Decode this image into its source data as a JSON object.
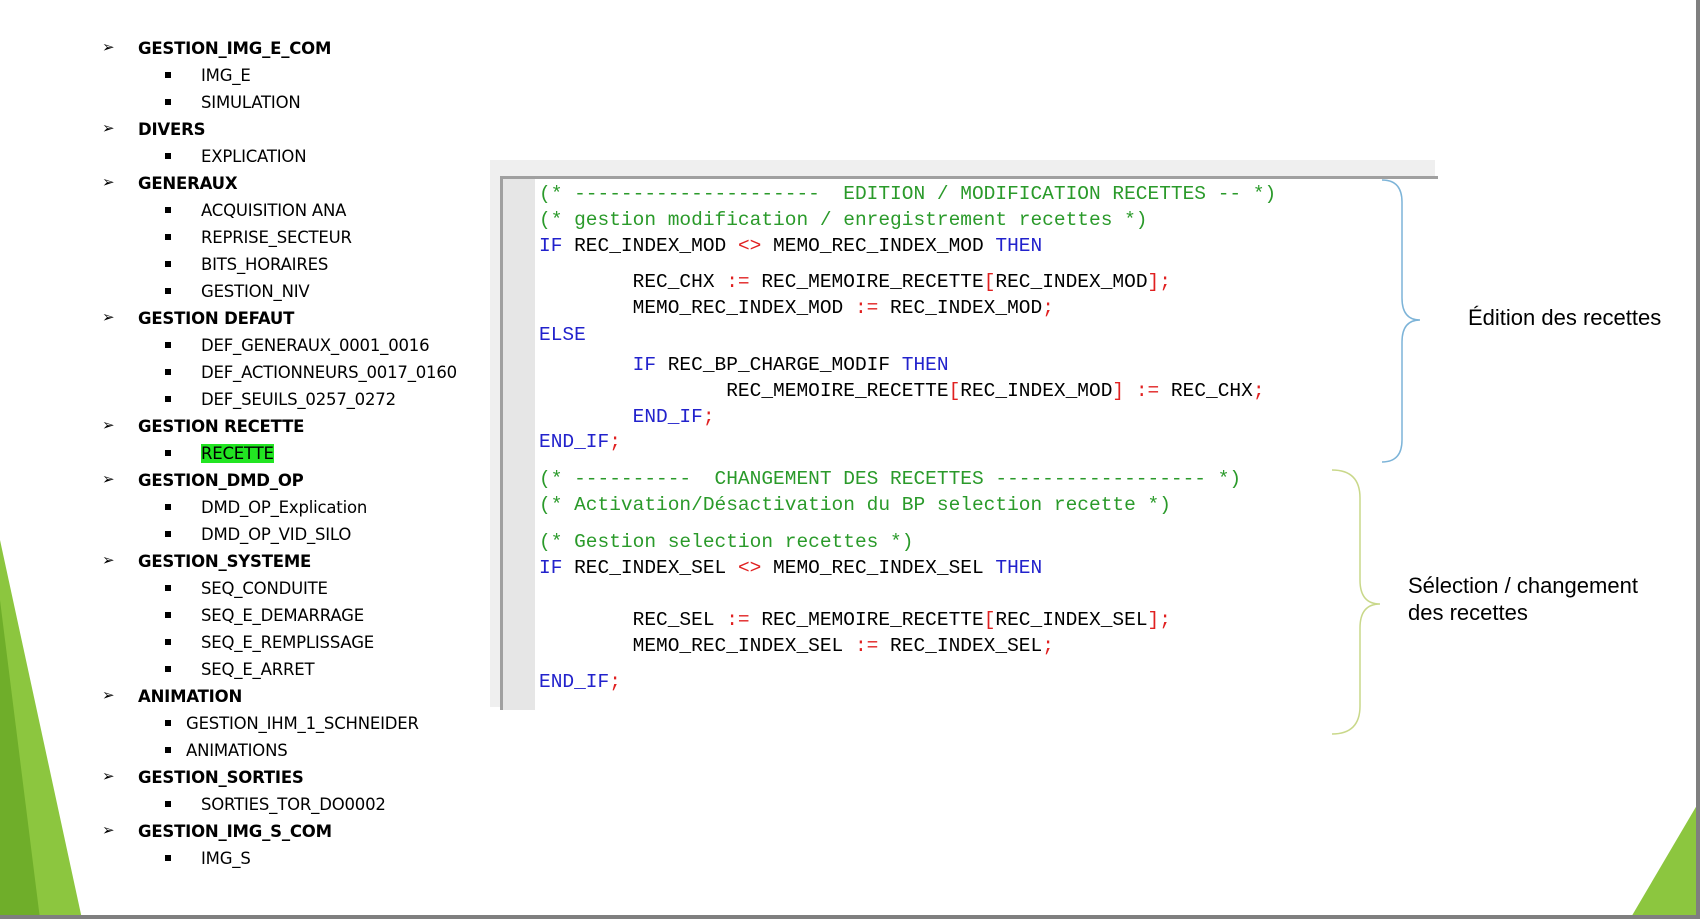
{
  "tree": {
    "groups": [
      {
        "label": "GESTION_IMG_E_COM",
        "items": [
          {
            "label": "IMG_E"
          },
          {
            "label": "SIMULATION"
          }
        ]
      },
      {
        "label": "DIVERS",
        "items": [
          {
            "label": "EXPLICATION"
          }
        ]
      },
      {
        "label": "GENERAUX",
        "items": [
          {
            "label": "ACQUISITION ANA"
          },
          {
            "label": "REPRISE_SECTEUR"
          },
          {
            "label": "BITS_HORAIRES"
          },
          {
            "label": "GESTION_NIV"
          }
        ]
      },
      {
        "label": "GESTION DEFAUT",
        "items": [
          {
            "label": "DEF_GENERAUX_0001_0016"
          },
          {
            "label": "DEF_ACTIONNEURS_0017_0160"
          },
          {
            "label": "DEF_SEUILS_0257_0272"
          }
        ]
      },
      {
        "label": "GESTION RECETTE",
        "items": [
          {
            "label": "RECETTE",
            "highlighted": true
          }
        ]
      },
      {
        "label": "GESTION_DMD_OP",
        "items": [
          {
            "label": "DMD_OP_Explication"
          },
          {
            "label": "DMD_OP_VID_SILO"
          }
        ]
      },
      {
        "label": "GESTION_SYSTEME",
        "items": [
          {
            "label": "SEQ_CONDUITE"
          },
          {
            "label": "SEQ_E_DEMARRAGE"
          },
          {
            "label": "SEQ_E_REMPLISSAGE"
          },
          {
            "label": "SEQ_E_ARRET"
          }
        ]
      },
      {
        "label": "ANIMATION",
        "items": [
          {
            "label": "GESTION_IHM_1_SCHNEIDER",
            "shallow": true
          },
          {
            "label": "ANIMATIONS",
            "shallow": true
          }
        ]
      },
      {
        "label": "GESTION_SORTIES",
        "items": [
          {
            "label": "SORTIES_TOR_DO0002"
          }
        ]
      },
      {
        "label": "GESTION_IMG_S_COM",
        "items": [
          {
            "label": "IMG_S"
          }
        ]
      }
    ],
    "highlight_color": "#22e522"
  },
  "code": {
    "colors": {
      "comment": "#2a9a2a",
      "keyword": "#2222cc",
      "operator": "#e02020",
      "text": "#000000"
    },
    "lines": [
      [
        [
          "cm",
          "(* ---------------------  EDITION / MODIFICATION RECETTES -- *)"
        ]
      ],
      [
        [
          "cm",
          "(* gestion modification / enregistrement recettes *)"
        ]
      ],
      [
        [
          "kw",
          "IF"
        ],
        [
          "",
          " REC_INDEX_MOD "
        ],
        [
          "op",
          "<>"
        ],
        [
          "",
          " MEMO_REC_INDEX_MOD "
        ],
        [
          "kw",
          "THEN"
        ]
      ],
      [
        [
          "",
          "        REC_CHX "
        ],
        [
          "op",
          ":="
        ],
        [
          "",
          " REC_MEMOIRE_RECETTE"
        ],
        [
          "op",
          "["
        ],
        [
          "",
          "REC_INDEX_MOD"
        ],
        [
          "op",
          "];"
        ]
      ],
      [
        [
          "",
          "        MEMO_REC_INDEX_MOD "
        ],
        [
          "op",
          ":="
        ],
        [
          "",
          " REC_INDEX_MOD"
        ],
        [
          "op",
          ";"
        ]
      ],
      [
        [
          "kw",
          "ELSE"
        ]
      ],
      [
        [
          "",
          "        "
        ],
        [
          "kw",
          "IF"
        ],
        [
          "",
          " REC_BP_CHARGE_MODIF "
        ],
        [
          "kw",
          "THEN"
        ]
      ],
      [
        [
          "",
          "                REC_MEMOIRE_RECETTE"
        ],
        [
          "op",
          "["
        ],
        [
          "",
          "REC_INDEX_MOD"
        ],
        [
          "op",
          "]"
        ],
        [
          "",
          " "
        ],
        [
          "op",
          ":="
        ],
        [
          "",
          " REC_CHX"
        ],
        [
          "op",
          ";"
        ]
      ],
      [
        [
          "",
          "        "
        ],
        [
          "kw",
          "END_IF"
        ],
        [
          "op",
          ";"
        ]
      ],
      [
        [
          "kw",
          "END_IF"
        ],
        [
          "op",
          ";"
        ]
      ],
      [
        [
          "cm",
          "(* ----------  CHANGEMENT DES RECETTES ------------------ *)"
        ]
      ],
      [
        [
          "cm",
          "(* Activation/Désactivation du BP selection recette *)"
        ]
      ],
      [
        [
          "cm",
          "(* Gestion selection recettes *)"
        ]
      ],
      [
        [
          "kw",
          "IF"
        ],
        [
          "",
          " REC_INDEX_SEL "
        ],
        [
          "op",
          "<>"
        ],
        [
          "",
          " MEMO_REC_INDEX_SEL "
        ],
        [
          "kw",
          "THEN"
        ]
      ],
      [
        [
          "",
          "        REC_SEL "
        ],
        [
          "op",
          ":="
        ],
        [
          "",
          " REC_MEMOIRE_RECETTE"
        ],
        [
          "op",
          "["
        ],
        [
          "",
          "REC_INDEX_SEL"
        ],
        [
          "op",
          "];"
        ]
      ],
      [
        [
          "",
          "        MEMO_REC_INDEX_SEL "
        ],
        [
          "op",
          ":="
        ],
        [
          "",
          " REC_INDEX_SEL"
        ],
        [
          "op",
          ";"
        ]
      ],
      [
        [
          "kw",
          "END_IF"
        ],
        [
          "op",
          ";"
        ]
      ]
    ]
  },
  "annotations": {
    "edition": "Édition des recettes",
    "selection_line1": "Sélection / changement",
    "selection_line2": "des recettes"
  },
  "colors": {
    "accent_green": "#8cc63f",
    "edition_brace": "#7db4d8",
    "selection_brace": "#c9d88a"
  }
}
